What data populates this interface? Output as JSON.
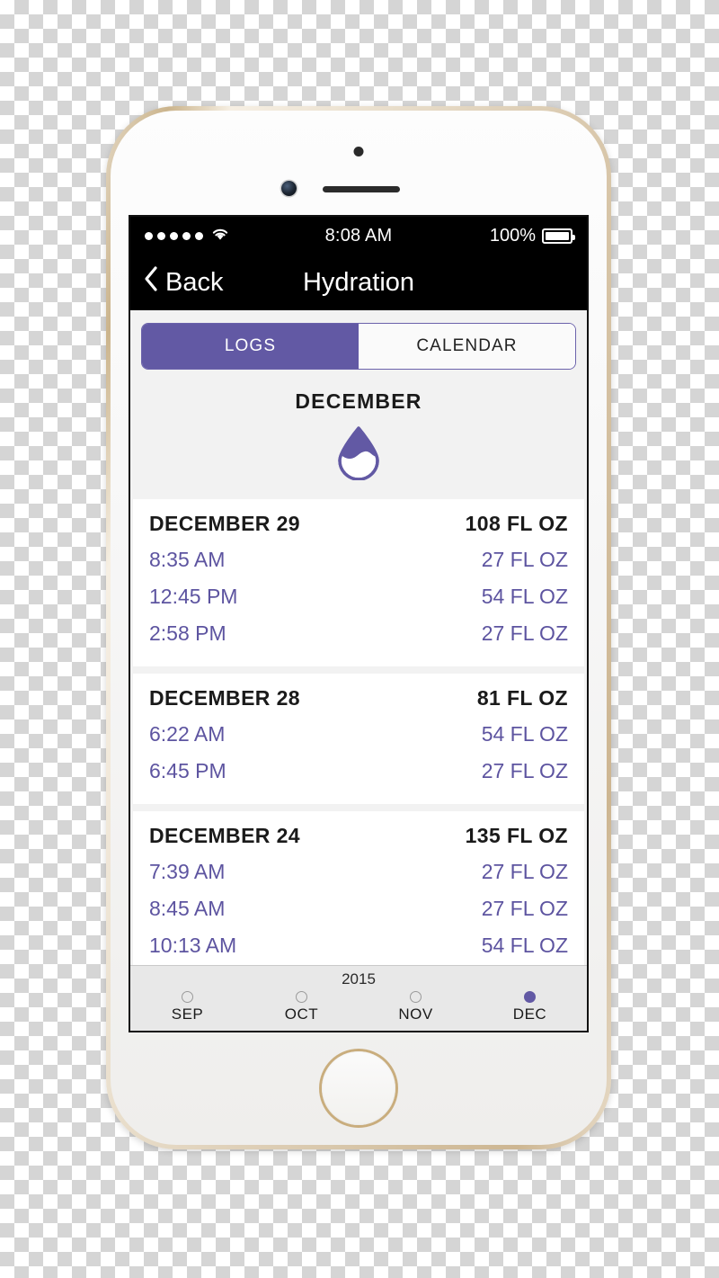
{
  "status_bar": {
    "signal_dots": 5,
    "wifi_icon": "wifi-icon",
    "time": "8:08 AM",
    "battery_percent": "100%"
  },
  "nav_bar": {
    "back_label": "Back",
    "back_icon": "chevron-left-icon",
    "title": "Hydration"
  },
  "segmented_control": {
    "tabs": [
      {
        "label": "LOGS",
        "active": true
      },
      {
        "label": "CALENDAR",
        "active": false
      }
    ]
  },
  "header": {
    "month_title": "DECEMBER",
    "icon": "water-droplet-icon"
  },
  "logs": [
    {
      "date": "DECEMBER 29",
      "total": "108 FL OZ",
      "entries": [
        {
          "time": "8:35 AM",
          "amount": "27 FL OZ"
        },
        {
          "time": "12:45 PM",
          "amount": "54 FL OZ"
        },
        {
          "time": "2:58 PM",
          "amount": "27 FL OZ"
        }
      ]
    },
    {
      "date": "DECEMBER 28",
      "total": "81 FL OZ",
      "entries": [
        {
          "time": "6:22 AM",
          "amount": "54 FL OZ"
        },
        {
          "time": "6:45 PM",
          "amount": "27 FL OZ"
        }
      ]
    },
    {
      "date": "DECEMBER 24",
      "total": "135 FL OZ",
      "entries": [
        {
          "time": "7:39 AM",
          "amount": "27 FL OZ"
        },
        {
          "time": "8:45 AM",
          "amount": "27 FL OZ"
        },
        {
          "time": "10:13 AM",
          "amount": "54 FL OZ"
        }
      ]
    }
  ],
  "month_selector": {
    "year": "2015",
    "months": [
      {
        "label": "SEP",
        "selected": false
      },
      {
        "label": "OCT",
        "selected": false
      },
      {
        "label": "NOV",
        "selected": false
      },
      {
        "label": "DEC",
        "selected": true
      }
    ]
  },
  "colors": {
    "accent_purple": "#6259a4",
    "entry_purple": "#5d54a0",
    "screen_bg": "#f2f2f2",
    "card_bg": "#ffffff",
    "nav_bg": "#000000",
    "month_bar_bg": "#e8e8e8"
  }
}
